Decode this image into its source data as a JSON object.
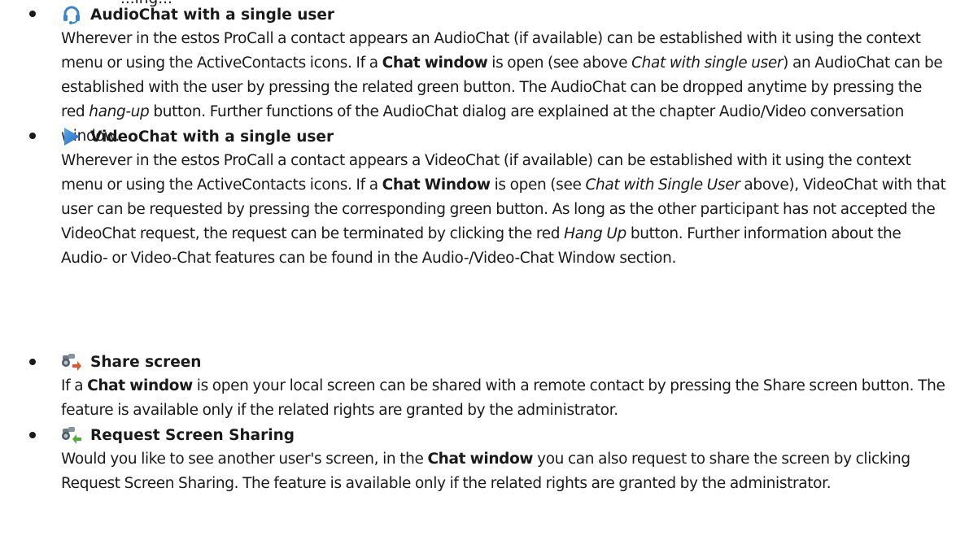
{
  "top_fragment": "...ing...",
  "items": [
    {
      "icon": "headset-icon",
      "title": "AudioChat with a single user",
      "body": [
        {
          "t": "Wherever in the estos ProCall a contact appears an AudioChat (if available) can be established with it using the context menu or using the ActiveContacts icons. If a "
        },
        {
          "t": "Chat window",
          "b": true
        },
        {
          "t": " is open (see above "
        },
        {
          "t": "Chat with single user",
          "i": true
        },
        {
          "t": ") an AudioChat can be established with the user by pressing the related green button. The AudioChat can be dropped anytime by pressing the red "
        },
        {
          "t": "hang-up",
          "i": true
        },
        {
          "t": " button. Further functions of the AudioChat dialog are explained at the chapter Audio/Video conversation window."
        }
      ]
    },
    {
      "icon": "play-icon",
      "title": "VideoChat with a single user",
      "body": [
        {
          "t": "Wherever in the estos ProCall a contact appears a VideoChat (if available) can be established with it using the context menu or using the ActiveContacts icons. If a "
        },
        {
          "t": "Chat Window",
          "b": true
        },
        {
          "t": " is open (see "
        },
        {
          "t": "Chat with Single User",
          "i": true
        },
        {
          "t": " above), VideoChat with that user can be requested by pressing the corresponding green button. As long as the other participant has not accepted the VideoChat request, the request can be terminated by clicking the red "
        },
        {
          "t": "Hang Up",
          "i": true
        },
        {
          "t": " button. Further information about the Audio- or Video-Chat features can be found in the Audio-/Video-Chat Window section."
        }
      ]
    },
    {
      "icon": "share-screen-icon",
      "title": "Share screen",
      "body": [
        {
          "t": "If a "
        },
        {
          "t": "Chat window",
          "b": true
        },
        {
          "t": " is open your local screen can be shared with a remote contact by pressing the Share screen button. The feature is available only if the related rights are granted by the administrator."
        }
      ]
    },
    {
      "icon": "request-screen-sharing-icon",
      "title": "Request Screen Sharing",
      "body": [
        {
          "t": "Would you like to see another user's screen, in the "
        },
        {
          "t": "Chat window",
          "b": true
        },
        {
          "t": " you can also request to share the screen by clicking Request Screen Sharing. The feature is available only if the related rights are granted by the administrator."
        }
      ]
    }
  ]
}
